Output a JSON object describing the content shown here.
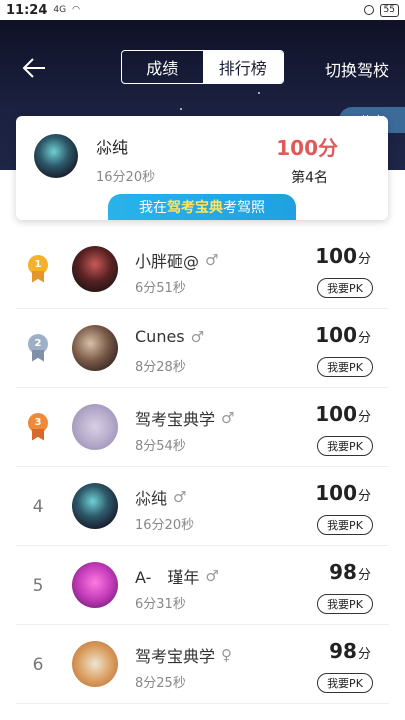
{
  "status_bar": {
    "time": "11:24",
    "signal": "4G",
    "battery": "55"
  },
  "header": {
    "tabs": [
      {
        "label": "成绩"
      },
      {
        "label": "排行榜"
      }
    ],
    "switch_school": "切换驾校",
    "share": "分享"
  },
  "my_card": {
    "name": "尛纯",
    "time": "16分20秒",
    "score": "100分",
    "rank": "第4名",
    "promo_prefix": "我在",
    "promo_brand": "驾考宝典",
    "promo_suffix": "考驾照"
  },
  "ranking": {
    "pk_label": "我要PK",
    "score_unit": "分",
    "rows": [
      {
        "rank": "1",
        "name": "小胖砸@",
        "gender": "♂",
        "time": "6分51秒",
        "score": "100"
      },
      {
        "rank": "2",
        "name": "Cunes",
        "gender": "♂",
        "time": "8分28秒",
        "score": "100"
      },
      {
        "rank": "3",
        "name": "驾考宝典学",
        "gender": "♂",
        "time": "8分54秒",
        "score": "100"
      },
      {
        "rank": "4",
        "name": "尛纯",
        "gender": "♂",
        "time": "16分20秒",
        "score": "100"
      },
      {
        "rank": "5",
        "name": "A-　瑾年",
        "gender": "♂",
        "time": "6分31秒",
        "score": "98"
      },
      {
        "rank": "6",
        "name": "驾考宝典学",
        "gender": "♀",
        "time": "8分25秒",
        "score": "98"
      }
    ]
  },
  "colors": {
    "header_bg": "#1b2140",
    "score_red": "#e05a5a",
    "promo_blue": "#29b3ea",
    "share_bg": "#3c6b9a"
  }
}
